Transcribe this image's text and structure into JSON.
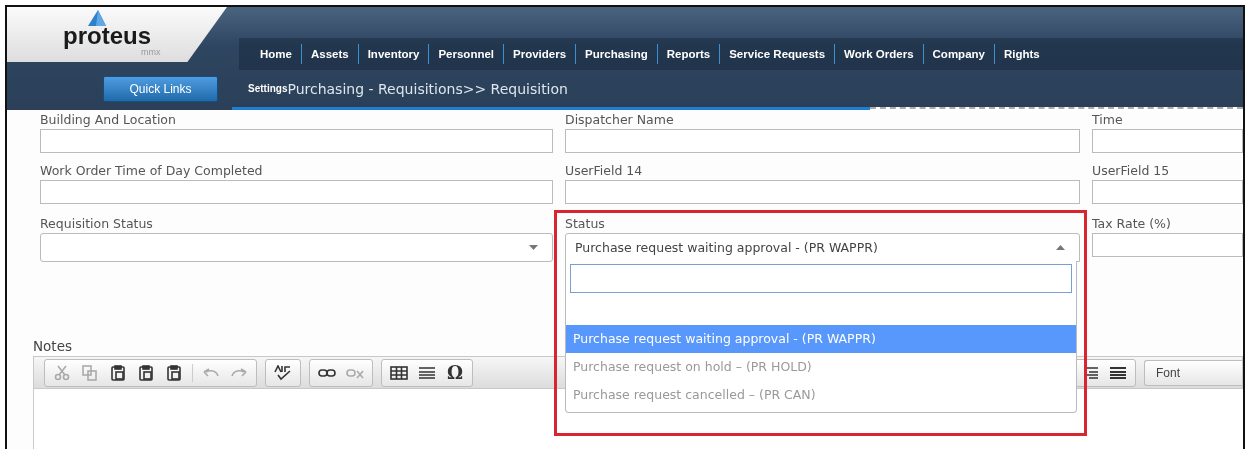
{
  "header": {
    "logo": {
      "name": "proteus",
      "tagline": "mmx"
    },
    "nav": [
      {
        "label": "Home"
      },
      {
        "label": "Assets"
      },
      {
        "label": "Inventory"
      },
      {
        "label": "Personnel"
      },
      {
        "label": "Providers"
      },
      {
        "label": "Purchasing"
      },
      {
        "label": "Reports"
      },
      {
        "label": "Service Requests"
      },
      {
        "label": "Work Orders"
      },
      {
        "label": "Company"
      },
      {
        "label": "Rights"
      }
    ],
    "quick_links": "Quick Links",
    "breadcrumb": {
      "lead": "Settings",
      "path": "Purchasing - Requisitions>> Requisition"
    }
  },
  "form": {
    "fields": [
      {
        "label": "Building And Location",
        "kind": "text"
      },
      {
        "label": "Dispatcher Name",
        "kind": "text"
      },
      {
        "label": "Time",
        "kind": "text"
      },
      {
        "label": "Work Order Time of Day Completed",
        "kind": "text"
      },
      {
        "label": "UserField 14",
        "kind": "text"
      },
      {
        "label": "UserField 15",
        "kind": "text"
      },
      {
        "label": "Requisition Status",
        "kind": "select",
        "open": false
      },
      {
        "label": "Status",
        "kind": "select",
        "open": true,
        "highlighted": true,
        "value": "Purchase request waiting approval - (PR WAPPR)"
      },
      {
        "label": "Tax Rate (%)",
        "kind": "text"
      }
    ]
  },
  "status_dropdown": {
    "options": [
      {
        "label": "Purchase request waiting approval - (PR WAPPR)",
        "selected": true,
        "disabled": false
      },
      {
        "label": "Purchase request on hold – (PR HOLD)",
        "selected": false,
        "disabled": true
      },
      {
        "label": "Purchase request cancelled – (PR CAN)",
        "selected": false,
        "disabled": true
      }
    ]
  },
  "notes": {
    "label": "Notes",
    "toolbar": {
      "groups": [
        [
          {
            "kind": "icon",
            "disabled": true
          },
          {
            "kind": "icon",
            "disabled": true
          },
          {
            "kind": "icon",
            "disabled": false
          },
          {
            "kind": "icon",
            "disabled": false
          },
          {
            "kind": "icon",
            "disabled": false
          },
          {
            "kind": "icon",
            "disabled": true
          },
          {
            "kind": "icon",
            "disabled": true
          }
        ],
        [
          {
            "kind": "icon",
            "disabled": false
          }
        ],
        [
          {
            "kind": "icon",
            "disabled": false
          },
          {
            "kind": "icon",
            "disabled": true
          }
        ],
        [
          {
            "kind": "icon",
            "disabled": false
          },
          {
            "kind": "icon",
            "disabled": false
          },
          {
            "kind": "glyph",
            "label": "Ω",
            "disabled": false
          }
        ]
      ]
    },
    "font": "Font"
  }
}
